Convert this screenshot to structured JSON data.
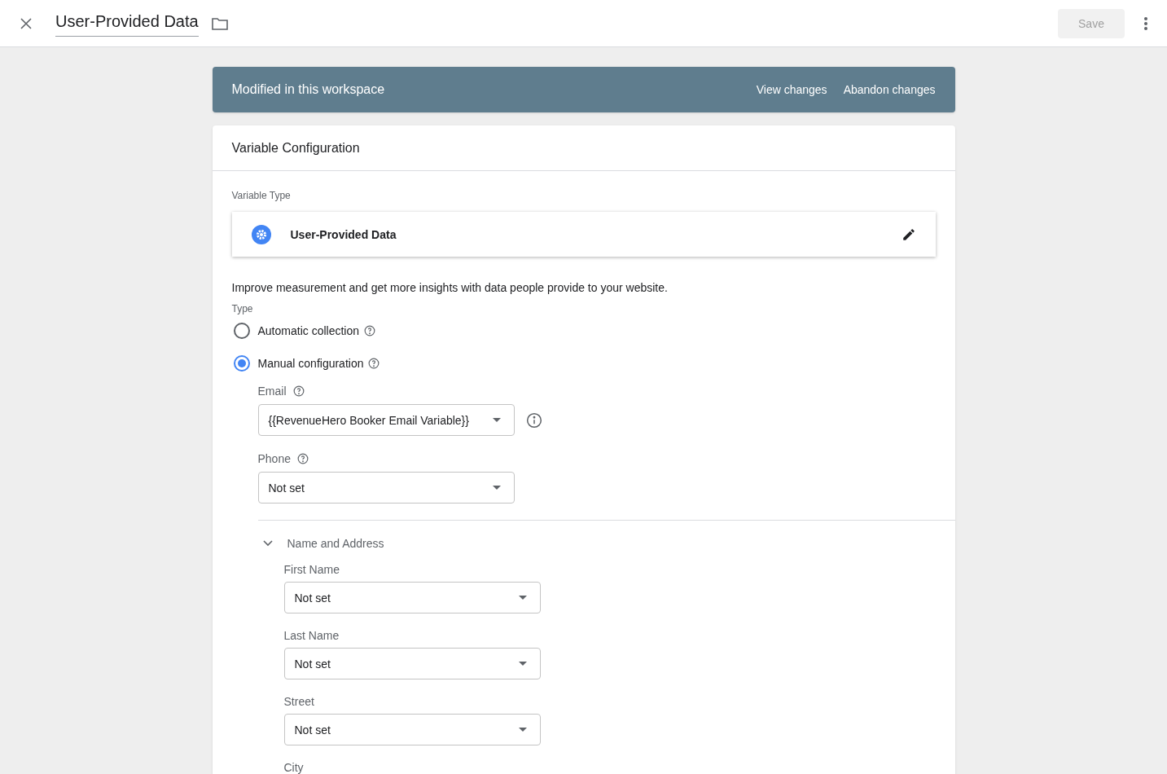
{
  "header": {
    "title": "User-Provided Data",
    "save": "Save"
  },
  "banner": {
    "text": "Modified in this workspace",
    "actions": [
      "View changes",
      "Abandon changes"
    ]
  },
  "card": {
    "title": "Variable Configuration",
    "variable_type_label": "Variable Type",
    "variable_type": "User-Provided Data",
    "description": "Improve measurement and get more insights with data people provide to your website.",
    "type_label": "Type",
    "type_options": [
      {
        "label": "Automatic collection",
        "selected": false
      },
      {
        "label": "Manual configuration",
        "selected": true
      }
    ],
    "fields": [
      {
        "label": "Email",
        "value": "{{RevenueHero Booker Email Variable}}",
        "info": true
      },
      {
        "label": "Phone",
        "value": "Not set",
        "info": false
      }
    ],
    "section": {
      "title": "Name and Address",
      "expanded": true,
      "fields": [
        {
          "label": "First Name",
          "value": "Not set"
        },
        {
          "label": "Last Name",
          "value": "Not set"
        },
        {
          "label": "Street",
          "value": "Not set"
        }
      ],
      "next_label": "City"
    }
  }
}
